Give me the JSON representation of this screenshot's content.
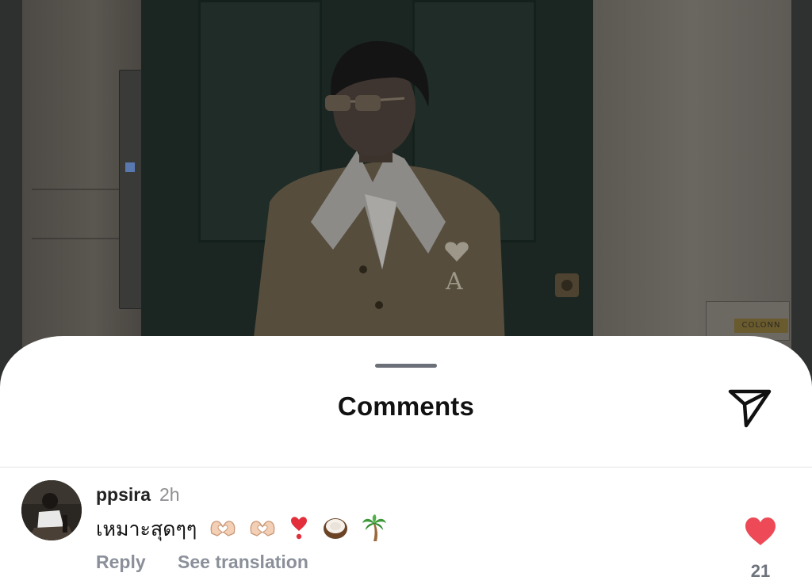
{
  "post_photo": {
    "plaque_text": "COLONN"
  },
  "sheet": {
    "title": "Comments",
    "share_icon": "paper-plane-icon"
  },
  "comments": [
    {
      "username": "ppsira",
      "time": "2h",
      "text": "เหมาะสุดๆๆ",
      "emojis": [
        "heart-hands-icon",
        "heart-hands-icon",
        "red-exclamation-icon",
        "coconut-icon",
        "palm-tree-icon"
      ],
      "reply_label": "Reply",
      "translate_label": "See translation",
      "like_icon": "heart-icon",
      "like_count": "21",
      "like_color": "#ed4956"
    }
  ],
  "colors": {
    "sheet_bg": "#ffffff",
    "secondary_text": "#8a8f99",
    "like_red": "#ed4956"
  }
}
